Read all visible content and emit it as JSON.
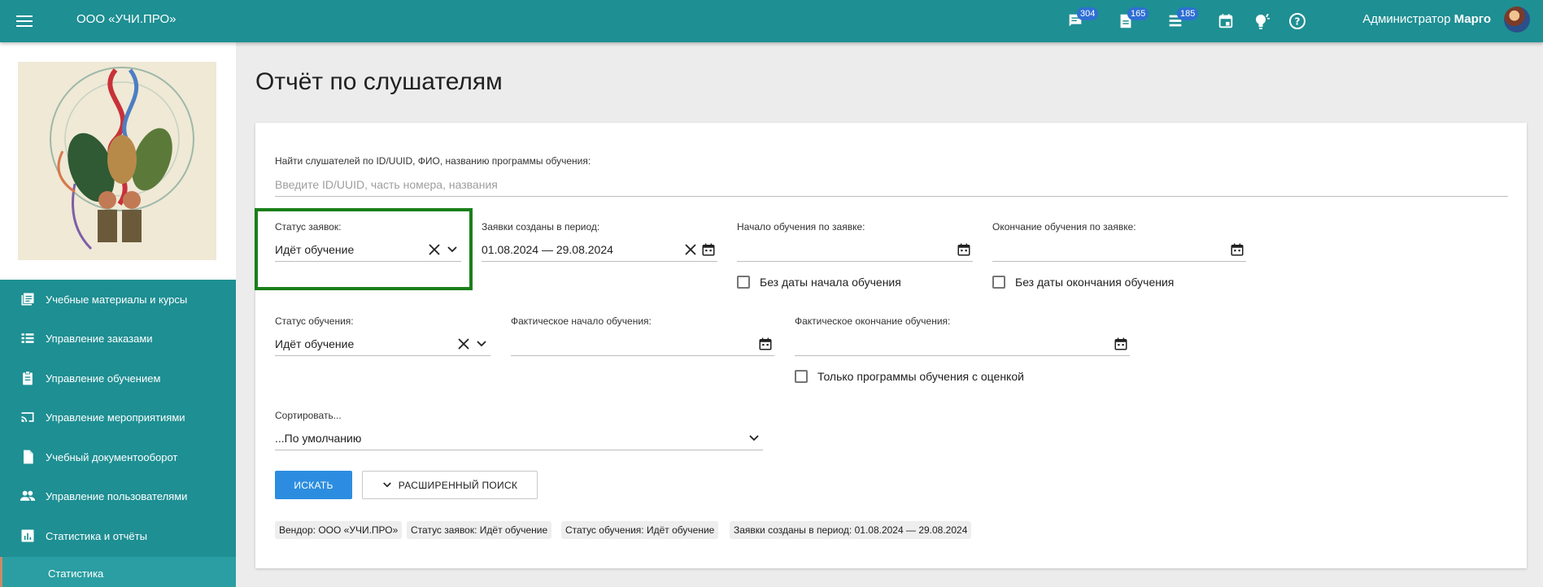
{
  "header": {
    "org_name": "ООО «УЧИ.ПРО»",
    "badges": {
      "messages": "304",
      "tasks": "165",
      "lists": "185"
    },
    "user_role": "Администратор",
    "user_name": "Марго"
  },
  "sidebar": {
    "items": [
      {
        "label": "Учебные материалы и курсы",
        "icon": "library-books-icon"
      },
      {
        "label": "Управление заказами",
        "icon": "list-icon"
      },
      {
        "label": "Управление обучением",
        "icon": "clipboard-icon"
      },
      {
        "label": "Управление мероприятиями",
        "icon": "cast-icon"
      },
      {
        "label": "Учебный документооборот",
        "icon": "document-icon"
      },
      {
        "label": "Управление пользователями",
        "icon": "people-icon"
      },
      {
        "label": "Статистика и отчёты",
        "icon": "chart-icon"
      }
    ],
    "active_sub": "Статистика"
  },
  "page": {
    "title": "Отчёт по слушателям"
  },
  "form": {
    "search_label": "Найти слушателей по ID/UUID, ФИО, названию программы обучения:",
    "search_placeholder": "Введите ID/UUID, часть номера, названия",
    "request_status_label": "Статус заявок:",
    "request_status_value": "Идёт обучение",
    "period_label": "Заявки созданы в период:",
    "period_value": "01.08.2024 — 29.08.2024",
    "start_label": "Начало обучения по заявке:",
    "end_label": "Окончание обучения по заявке:",
    "no_start_label": "Без даты начала обучения",
    "no_end_label": "Без даты окончания обучения",
    "study_status_label": "Статус обучения:",
    "study_status_value": "Идёт обучение",
    "actual_start_label": "Фактическое начало обучения:",
    "actual_end_label": "Фактическое окончание обучения:",
    "graded_only_label": "Только программы обучения с оценкой",
    "sort_label": "Сортировать...",
    "sort_value": "...По умолчанию",
    "search_button": "ИСКАТЬ",
    "advanced_button": "РАСШИРЕННЫЙ ПОИСК"
  },
  "chips": [
    "Вендор: ООО «УЧИ.ПРО»",
    "Статус заявок: Идёт обучение",
    "Статус обучения: Идёт обучение",
    "Заявки созданы в период: 01.08.2024 — 29.08.2024"
  ],
  "colors": {
    "primary": "#1e8f93",
    "accent_button": "#2c8de0",
    "highlight": "#1a7f1a"
  }
}
